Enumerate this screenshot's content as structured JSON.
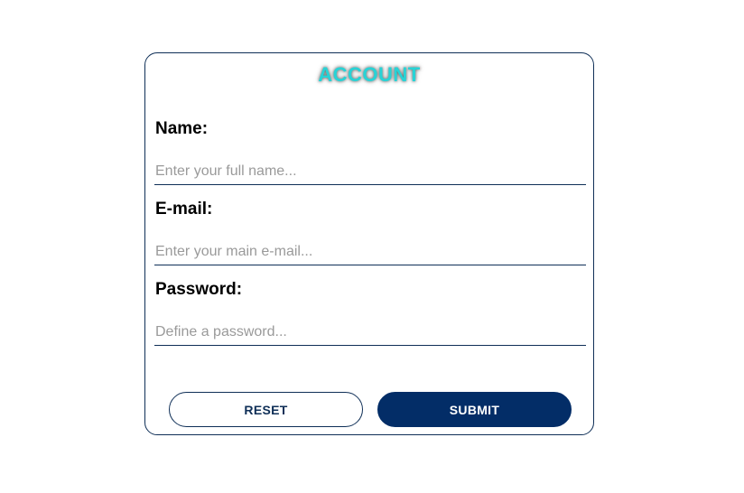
{
  "form": {
    "title": "ACCOUNT",
    "fields": [
      {
        "label": "Name:",
        "placeholder": "Enter your full name...",
        "value": ""
      },
      {
        "label": "E-mail:",
        "placeholder": "Enter your main e-mail...",
        "value": ""
      },
      {
        "label": "Password:",
        "placeholder": "Define a password...",
        "value": ""
      }
    ],
    "buttons": {
      "reset_label": "RESET",
      "submit_label": "SUBMIT"
    }
  },
  "colors": {
    "title": "#27d3d6",
    "border": "#0f2f57",
    "submit_bg": "#032d67",
    "placeholder": "#9a9a9a"
  }
}
